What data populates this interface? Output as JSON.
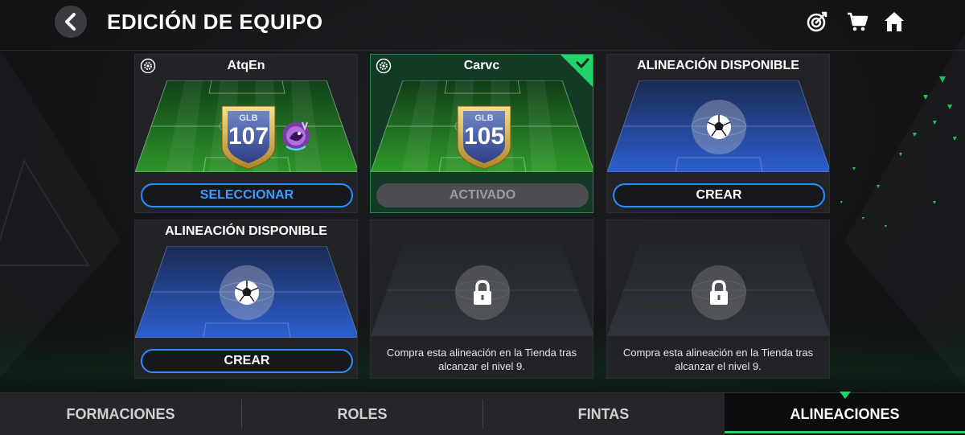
{
  "header": {
    "title": "EDICIÓN DE EQUIPO",
    "back_icon": "chevron-left-icon",
    "icons": [
      "target-icon",
      "cart-icon",
      "home-icon"
    ]
  },
  "lineups": [
    {
      "title": "AtqEn",
      "state": "saved",
      "badge_label": "GLB",
      "badge_value": "107",
      "button": "SELECCIONAR",
      "has_crest": true
    },
    {
      "title": "Carvc",
      "state": "active",
      "badge_label": "GLB",
      "badge_value": "105",
      "button": "ACTIVADO"
    },
    {
      "title": "ALINEACIÓN DISPONIBLE",
      "state": "available",
      "button": "CREAR"
    },
    {
      "title": "ALINEACIÓN DISPONIBLE",
      "state": "available",
      "button": "CREAR"
    },
    {
      "state": "locked",
      "message": "Compra esta alineación en la Tienda tras alcanzar el nivel 9."
    },
    {
      "state": "locked",
      "message": "Compra esta alineación en la Tienda tras alcanzar el nivel 9."
    }
  ],
  "tabs": [
    {
      "label": "FORMACIONES",
      "selected": false
    },
    {
      "label": "ROLES",
      "selected": false
    },
    {
      "label": "FINTAS",
      "selected": false
    },
    {
      "label": "ALINEACIONES",
      "selected": true
    }
  ],
  "colors": {
    "accent_green": "#22d36a",
    "button_blue": "#2b8cff",
    "active_card": "#133a24"
  }
}
